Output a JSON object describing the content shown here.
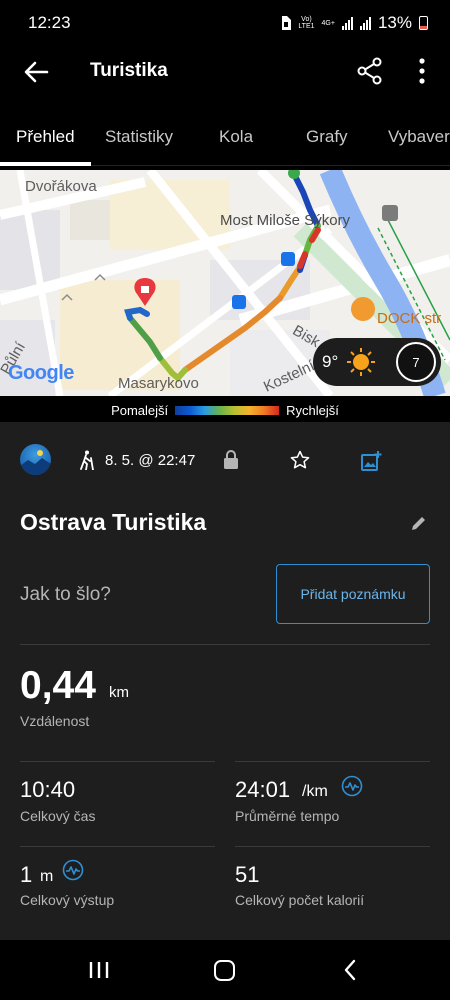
{
  "status_bar": {
    "time": "12:23",
    "network_top": "Vo)",
    "network_bottom": "LTE1",
    "net_gen": "4G+",
    "battery": "13%"
  },
  "app_bar": {
    "title": "Turistika"
  },
  "tabs": [
    "Přehled",
    "Statistiky",
    "Kola",
    "Grafy",
    "Vybaver"
  ],
  "map": {
    "street_labels": [
      "Dvořákova",
      "Most Miloše Sýkory",
      "DOCK str",
      "Bisk",
      "Kostelní",
      "Masarykovo",
      "Půlní"
    ],
    "google_logo": "Google",
    "weather_temp": "9°",
    "wind_speed": "7"
  },
  "legend": {
    "slower": "Pomalejší",
    "faster": "Rychlejší"
  },
  "activity": {
    "date": "8. 5. @ 22:47",
    "title": "Ostrava Turistika",
    "prompt": "Jak to šlo?",
    "add_note_label": "Přidat poznámku",
    "distance": {
      "value": "0,44",
      "unit": "km",
      "label": "Vzdálenost"
    },
    "stats": [
      {
        "value": "10:40",
        "unit": "",
        "label": "Celkový čas"
      },
      {
        "value": "24:01",
        "unit": "/km",
        "label": "Průměrné tempo"
      },
      {
        "value": "1",
        "unit": "m",
        "label": "Celkový výstup"
      },
      {
        "value": "51",
        "unit": "",
        "label": "Celkový počet kalorií"
      }
    ]
  },
  "colors": {
    "accent_blue": "#2f8fd3",
    "route_start": "#3aa84b",
    "route_end_pin": "#e8373f",
    "background": "#1e1e1e"
  }
}
